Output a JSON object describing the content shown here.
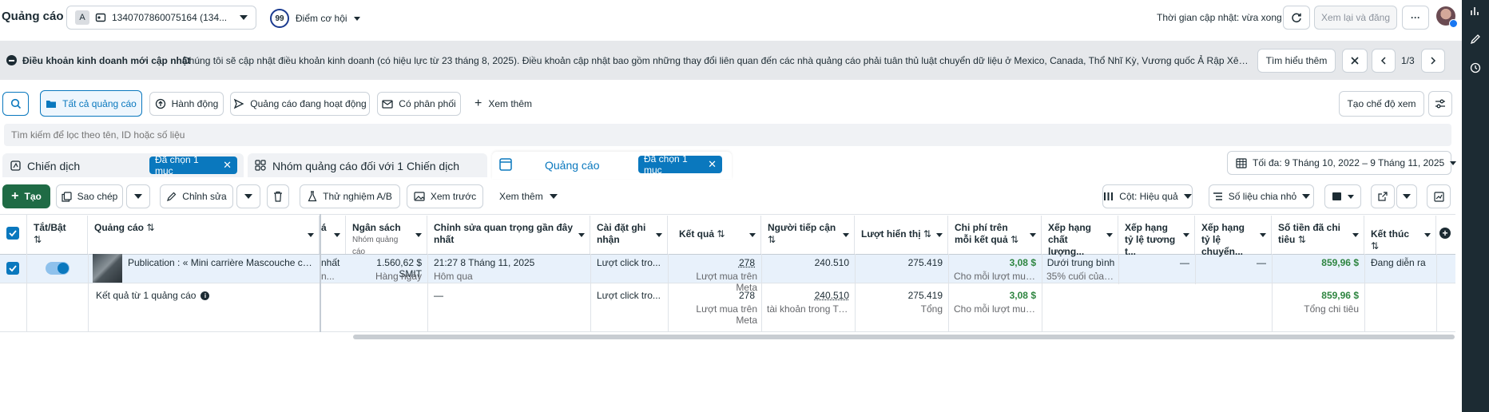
{
  "topbar": {
    "title": "Quảng cáo",
    "account_letter": "A",
    "account_label": "1340707860075164 (134...",
    "score": "99",
    "score_label": "Điểm cơ hội",
    "update_time": "Thời gian cập nhật: vừa xong",
    "review_publish": "Xem lại và đăng",
    "more": "···"
  },
  "notice": {
    "title": "Điều khoản kinh doanh mới cập nhật",
    "body": "Chúng tôi sẽ cập nhật điều khoản kinh doanh (có hiệu lực từ 23 tháng 8, 2025). Điều khoản cập nhật bao gồm những thay đổi liên quan đến các nhà quảng cáo phải tuân thủ luật chuyển dữ liệu ở Mexico, Canada, Thổ Nhĩ Kỳ, Vương quốc Ả Rập Xê Út, Trung Mỹ và N...",
    "learn_more": "Tìm hiểu thêm",
    "page": "1/3"
  },
  "filters": {
    "all_ads": "Tất cả quảng cáo",
    "actions": "Hành động",
    "active_ads": "Quảng cáo đang hoạt động",
    "has_delivery": "Có phân phối",
    "see_more": "Xem thêm",
    "create_view": "Tạo chế độ xem",
    "search_placeholder": "Tìm kiếm để lọc theo tên, ID hoặc số liệu"
  },
  "tabs": {
    "campaigns": "Chiến dịch",
    "campaign_selected": "Đã chọn 1 mục",
    "adsets": "Nhóm quảng cáo đối với 1 Chiến dịch",
    "ads": "Quảng cáo",
    "ads_selected": "Đã chọn 1 mục",
    "date_range": "Tối đa: 9 Tháng 10, 2022 – 9 Tháng 11, 2025"
  },
  "toolbar": {
    "create": "Tạo",
    "duplicate": "Sao chép",
    "edit": "Chỉnh sửa",
    "ab_test": "Thử nghiệm A/B",
    "preview": "Xem trước",
    "see_more": "Xem thêm",
    "columns": "Cột: Hiệu quả",
    "breakdown": "Số liệu chia nhỏ"
  },
  "table": {
    "headers": {
      "toggle": "Tắt/Bật",
      "ad": "Quảng cáo",
      "budget": "Ngân sách",
      "budget_sub": "",
      "last_edit": "Chỉnh sửa quan trọng gần đây nhất",
      "attribution": "Cài đặt ghi nhận",
      "results": "Kết quả",
      "reach": "Người tiếp cận",
      "impressions": "Lượt hiển thị",
      "cost": "Chi phí trên mỗi kết quả",
      "quality": "Xếp hạng chất lượng...",
      "engagement": "Xếp hạng tỷ lệ tương t...",
      "conversion": "Xếp hạng tỷ lệ chuyển...",
      "spent": "Số tiền đã chi tiêu",
      "ends": "Kết thúc"
    },
    "row": {
      "name": "Publication : « Mini carrière Mascouche c'es...",
      "partial_a": "nhất",
      "partial_b": "n...",
      "budget": "1.560,62 $ SMIT",
      "budget_sub": "Hàng ngày",
      "last_edit": "21:27 8 Tháng 11, 2025",
      "last_edit_sub": "Hôm qua",
      "attribution": "Lượt click tro...",
      "results": "278",
      "results_sub": "Lượt mua trên Meta",
      "reach": "240.510",
      "impressions": "275.419",
      "cost": "3,08 $",
      "cost_sub": "Cho mỗi lượt mua trê...",
      "quality": "Dưới trung bình",
      "quality_sub": "35% cuối của qu...",
      "engagement": "—",
      "conversion": "—",
      "spent": "859,96 $",
      "ends": "Đang diễn ra"
    },
    "summary": {
      "label": "Kết quả từ 1 quảng cáo",
      "last_edit": "—",
      "attribution": "Lượt click tro...",
      "results": "278",
      "results_sub": "Lượt mua trên Meta",
      "reach": "240.510",
      "reach_sub": "tài khoản trong Trung ...",
      "impressions": "275.419",
      "impressions_sub": "Tổng",
      "cost": "3,08 $",
      "cost_sub": "Cho mỗi lượt mua trê...",
      "spent": "859,96 $",
      "spent_sub": "Tổng chi tiêu"
    }
  },
  "colors": {
    "primary": "#0a78be",
    "create_green": "#1f6b45",
    "banner": "#eaecef",
    "selected_row": "#e8f1fb"
  }
}
